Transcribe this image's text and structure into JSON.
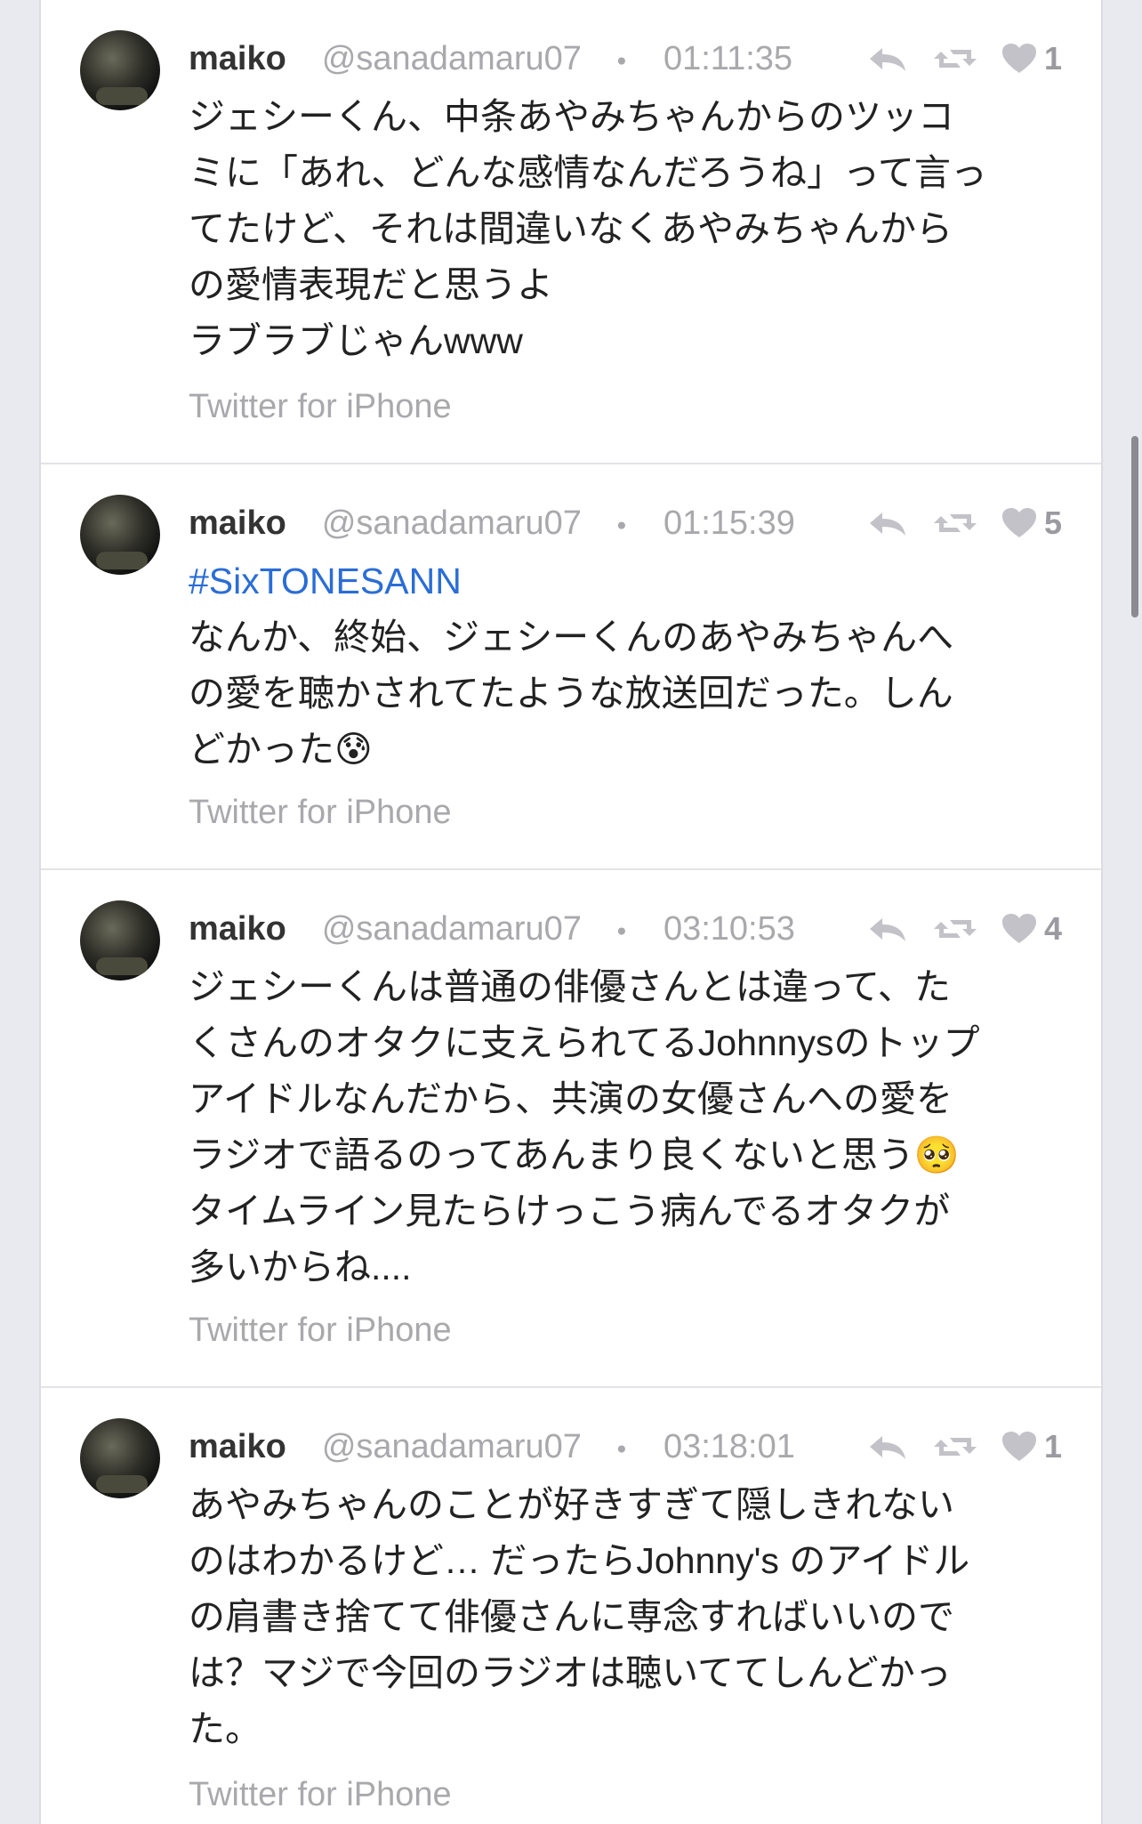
{
  "tweets": [
    {
      "name": "maiko",
      "handle": "@sanadamaru07",
      "dot": "・",
      "time": "01:11:35",
      "likes": "1",
      "lines": [
        "ジェシーくん、中条あやみちゃんからのツッコ",
        "ミに「あれ、どんな感情なんだろうね」って言っ",
        "てたけど、それは間違いなくあやみちゃんから",
        "の愛情表現だと思うよ",
        "ラブラブじゃんwww"
      ],
      "source": "Twitter for iPhone"
    },
    {
      "name": "maiko",
      "handle": "@sanadamaru07",
      "dot": "・",
      "time": "01:15:39",
      "likes": "5",
      "hashtag": "#SixTONESANN",
      "lines": [
        "なんか、終始、ジェシーくんのあやみちゃんへ",
        "の愛を聴かされてたような放送回だった。しん",
        "どかった😰"
      ],
      "source": "Twitter for iPhone"
    },
    {
      "name": "maiko",
      "handle": "@sanadamaru07",
      "dot": "・",
      "time": "03:10:53",
      "likes": "4",
      "lines": [
        "ジェシーくんは普通の俳優さんとは違って、た",
        "くさんのオタクに支えられてるJohnnysのトップ",
        "アイドルなんだから、共演の女優さんへの愛を",
        "ラジオで語るのってあんまり良くないと思う🥺",
        "タイムライン見たらけっこう病んでるオタクが",
        "多いからね...."
      ],
      "source": "Twitter for iPhone"
    },
    {
      "name": "maiko",
      "handle": "@sanadamaru07",
      "dot": "・",
      "time": "03:18:01",
      "likes": "1",
      "lines": [
        "あやみちゃんのことが好きすぎて隠しきれない",
        "のはわかるけど… だったらJohnny's のアイドル",
        "の肩書き捨てて俳優さんに専念すればいいので",
        "は？マジで今回のラジオは聴いててしんどかっ",
        "た。"
      ],
      "source": "Twitter for iPhone"
    }
  ],
  "icons": {
    "reply": "reply-icon",
    "retweet": "retweet-icon",
    "like": "heart-icon"
  },
  "colors": {
    "background": "#e9e9f0",
    "card": "#ffffff",
    "text": "#222222",
    "muted": "#a9a9ad",
    "hashtag": "#2a6dd6",
    "icon": "#c2c2c8"
  }
}
